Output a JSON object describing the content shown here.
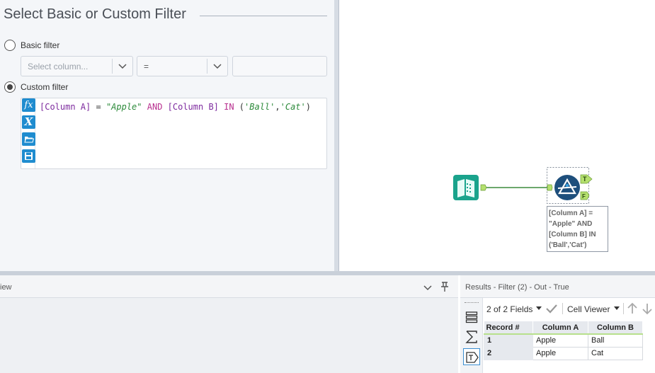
{
  "config": {
    "title": "Select Basic or Custom Filter",
    "basic_filter": {
      "label": "Basic filter",
      "column_placeholder": "Select column...",
      "operator": "=",
      "value": ""
    },
    "custom_filter": {
      "label": "Custom filter",
      "expression_tokens": [
        {
          "text": "[Column A]",
          "kind": "col"
        },
        {
          "text": " = ",
          "kind": "op"
        },
        {
          "text": "\"Apple\"",
          "kind": "str"
        },
        {
          "text": " AND ",
          "kind": "kw"
        },
        {
          "text": "[Column B]",
          "kind": "col"
        },
        {
          "text": " IN ",
          "kind": "kw"
        },
        {
          "text": "(",
          "kind": "op"
        },
        {
          "text": "'Ball'",
          "kind": "str"
        },
        {
          "text": ",",
          "kind": "op"
        },
        {
          "text": "'Cat'",
          "kind": "str"
        },
        {
          "text": ")",
          "kind": "op"
        }
      ],
      "fx_label": "fx",
      "var_label": "X"
    }
  },
  "canvas": {
    "filter_tool": {
      "true_anchor": "T",
      "false_anchor": "F",
      "annotation": "[Column A] = \"Apple\" AND [Column B] IN ('Ball','Cat')"
    }
  },
  "left_pane": {
    "title": "iew"
  },
  "results": {
    "title": "Results - Filter (2) - Out - True",
    "fields_selector": "2 of 2 Fields",
    "cell_viewer": "Cell Viewer",
    "columns": [
      "Record #",
      "Column A",
      "Column B"
    ],
    "rows": [
      [
        "1",
        "Apple",
        "Ball"
      ],
      [
        "2",
        "Apple",
        "Cat"
      ]
    ]
  },
  "colors": {
    "accent_blue": "#1f8ccf",
    "input_tool_teal": "#1aa38c",
    "filter_tool_navy": "#1e4f7c",
    "connector_green": "#3c8c3c",
    "anchor_green": "#b5e06e"
  }
}
